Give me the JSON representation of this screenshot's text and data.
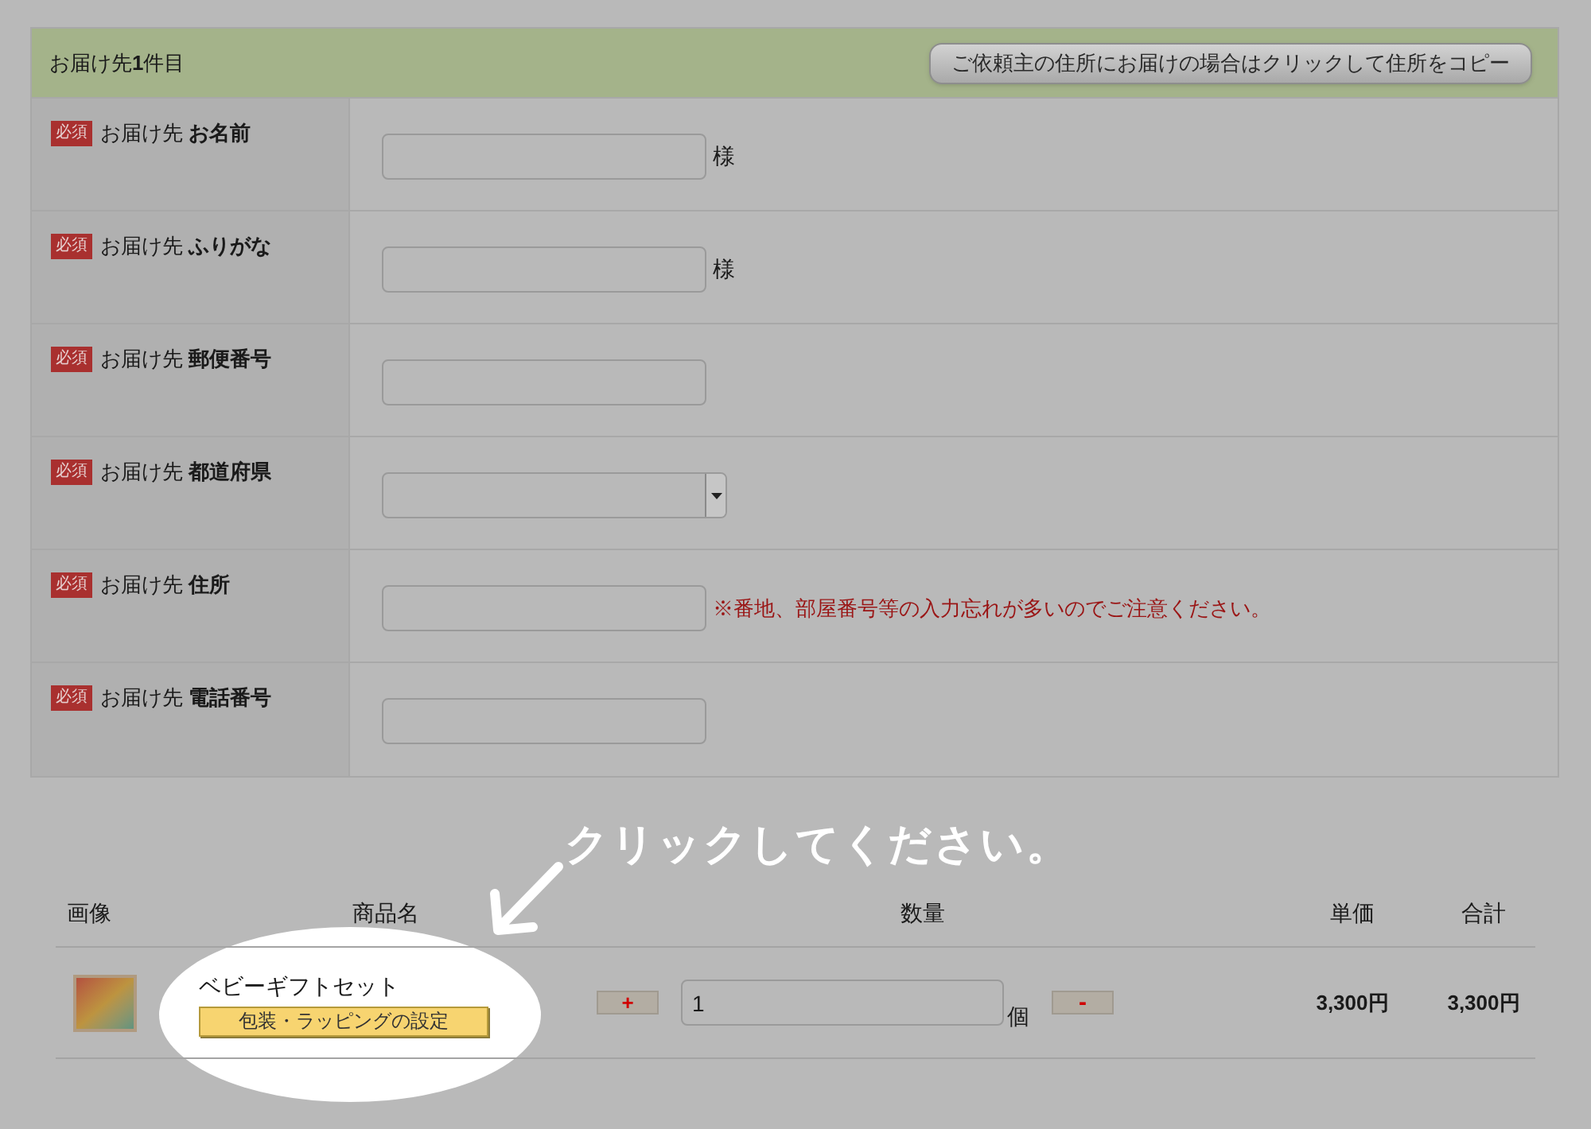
{
  "form": {
    "title": "お届け先**1**件目",
    "copy_button": "ご依頼主の住所にお届けの場合はクリックして住所をコピー",
    "fields": [
      {
        "badge": "必須",
        "label": "お届け先 **お名前**",
        "kind": "text",
        "suffix": "様"
      },
      {
        "badge": "必須",
        "label": "お届け先 **ふりがな**",
        "kind": "text",
        "suffix": "様"
      },
      {
        "badge": "必須",
        "label": "お届け先 **郵便番号**",
        "kind": "text"
      },
      {
        "badge": "必須",
        "label": "お届け先 **都道府県**",
        "kind": "select"
      },
      {
        "badge": "必須",
        "label": "お届け先 **住所**",
        "kind": "text",
        "note": "※番地、部屋番号等の入力忘れが多いのでご注意ください。"
      },
      {
        "badge": "必須",
        "label": "お届け先 **電話番号**",
        "kind": "text"
      }
    ]
  },
  "annotation": {
    "text": "クリックしてください。"
  },
  "cart": {
    "columns": [
      "画像",
      "商品名",
      "数量",
      "単価",
      "合計"
    ],
    "items": [
      {
        "name": "ベビーギフトセット",
        "wrap_button": "包装・ラッピングの設定",
        "plus": "+",
        "quantity": "1",
        "unit": "個",
        "minus": "-",
        "unit_price": "3,300円",
        "total": "3,300円"
      }
    ]
  }
}
